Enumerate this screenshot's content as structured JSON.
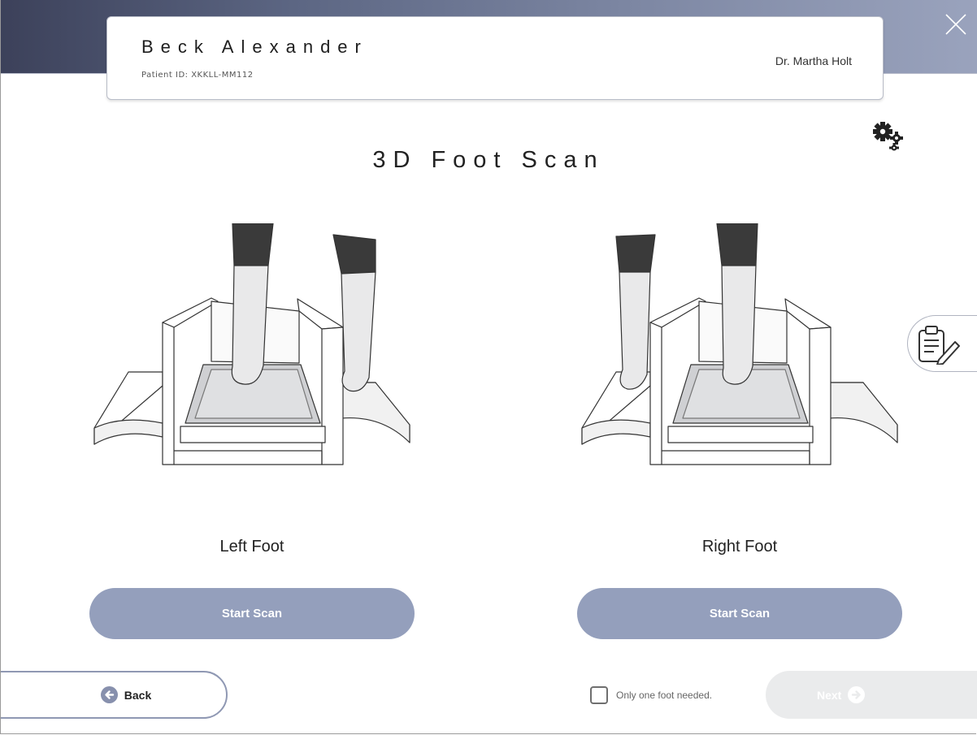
{
  "header": {
    "patient_name": "Beck Alexander",
    "patient_id": "Patient ID: XKKLL-MM112",
    "doctor": "Dr. Martha Holt",
    "close_icon": "close-icon"
  },
  "page": {
    "title": "3D Foot Scan",
    "settings_icon": "gears-icon",
    "notes_icon": "clipboard-edit-icon"
  },
  "scans": [
    {
      "label": "Left Foot",
      "button": "Start Scan"
    },
    {
      "label": "Right Foot",
      "button": "Start Scan"
    }
  ],
  "footer": {
    "back_label": "Back",
    "checkbox_label": "Only one foot needed.",
    "checkbox_checked": false,
    "next_label": "Next"
  },
  "colors": {
    "header_gradient_start": "#3c415a",
    "header_gradient_end": "#9aa3bd",
    "button": "#949fbc",
    "next_disabled": "#eaebec"
  }
}
